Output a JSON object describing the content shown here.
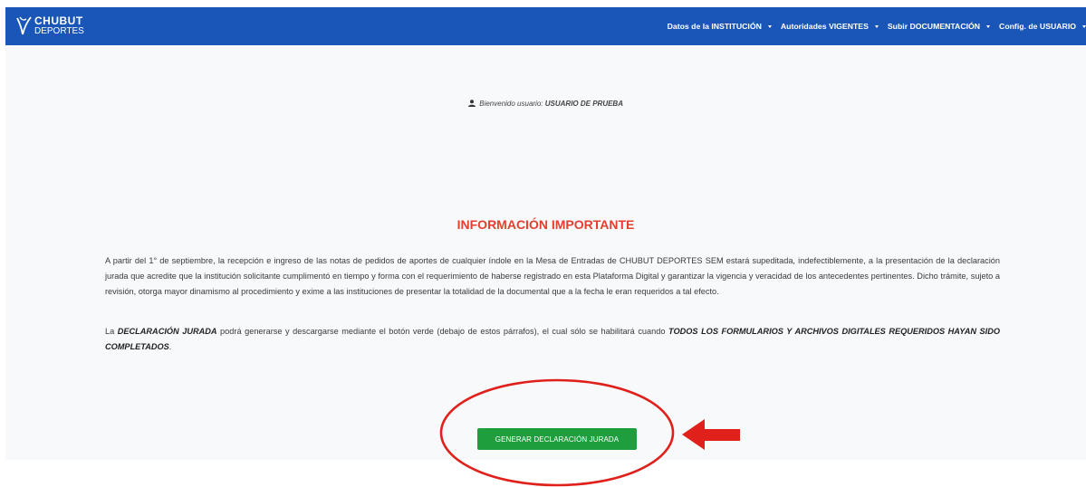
{
  "brand": {
    "line1": "CHUBUT",
    "line2": "DEPORTES"
  },
  "nav": {
    "items": [
      {
        "label": "Datos de la INSTITUCIÓN",
        "icon": "caret-down-icon"
      },
      {
        "label": "Autoridades VIGENTES",
        "icon": "caret-down-icon"
      },
      {
        "label": "Subir DOCUMENTACIÓN",
        "icon": "caret-down-icon"
      },
      {
        "label": "Config. de USUARIO",
        "icon": "caret-down-icon"
      }
    ]
  },
  "welcome": {
    "icon": "user-icon",
    "prefix": "Bienvenido usuario:",
    "username": "USUARIO DE PRUEBA"
  },
  "info": {
    "heading": "INFORMACIÓN IMPORTANTE",
    "paragraph1": "A partir del 1° de septiembre, la recepción e ingreso de las notas de pedidos de aportes de cualquier índole en la Mesa de Entradas de CHUBUT DEPORTES SEM estará supeditada, indefectiblemente, a la presentación de la declaración jurada que acredite que la institución solicitante cumplimentó en tiempo y forma con el requerimiento de haberse registrado en esta Plataforma Digital y garantizar la vigencia y veracidad de los antecedentes pertinentes. Dicho trámite, sujeto a revisión, otorga mayor dinamismo al procedimiento y exime a las instituciones de presentar la totalidad de la documental que a la fecha le eran requeridos a tal efecto.",
    "paragraph2_start": "La ",
    "paragraph2_em1": "DECLARACIÓN JURADA",
    "paragraph2_mid": " podrá generarse y descargarse mediante el botón verde (debajo de estos párrafos), el cual sólo se habilitará cuando ",
    "paragraph2_em2": "TODOS LOS FORMULARIOS Y ARCHIVOS DIGITALES REQUERIDOS HAYAN SIDO COMPLETADOS",
    "paragraph2_end": "."
  },
  "action": {
    "generate_label": "GENERAR DECLARACIÓN JURADA"
  },
  "colors": {
    "navbar": "#1a56b8",
    "heading": "#e43f2e",
    "button": "#1f9e3e",
    "annotation": "#e0201b"
  }
}
